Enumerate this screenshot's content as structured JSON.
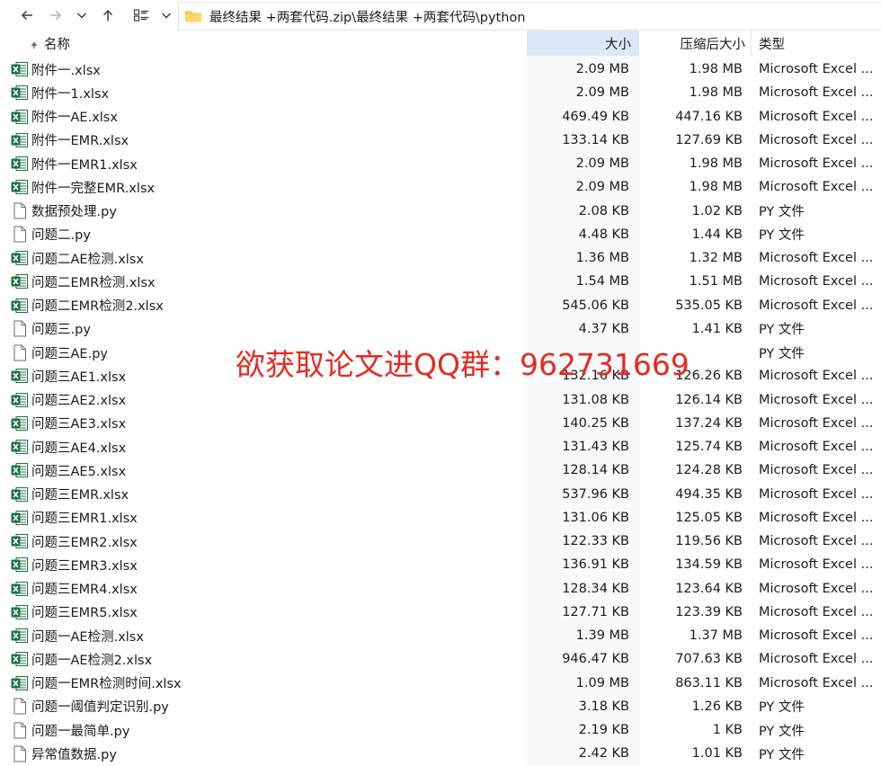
{
  "navigation": {
    "back_icon": "arrow-left-icon",
    "forward_icon": "arrow-right-icon",
    "recent_icon": "chevron-down-icon",
    "up_icon": "arrow-up-icon",
    "view_icon": "view-layout-icon",
    "view_menu_icon": "chevron-down-icon"
  },
  "address_bar": {
    "path": "最终结果 +两套代码.zip\\最终结果 +两套代码\\python"
  },
  "columns": {
    "name": "名称",
    "size": "大小",
    "compressed": "压缩后大小",
    "type": "类型"
  },
  "files": [
    {
      "name": "附件一.xlsx",
      "size": "2.09 MB",
      "compressed": "1.98 MB",
      "type": "Microsoft Excel ...",
      "icon": "excel"
    },
    {
      "name": "附件一1.xlsx",
      "size": "2.09 MB",
      "compressed": "1.98 MB",
      "type": "Microsoft Excel ...",
      "icon": "excel"
    },
    {
      "name": "附件一AE.xlsx",
      "size": "469.49 KB",
      "compressed": "447.16 KB",
      "type": "Microsoft Excel ...",
      "icon": "excel"
    },
    {
      "name": "附件一EMR.xlsx",
      "size": "133.14 KB",
      "compressed": "127.69 KB",
      "type": "Microsoft Excel ...",
      "icon": "excel"
    },
    {
      "name": "附件一EMR1.xlsx",
      "size": "2.09 MB",
      "compressed": "1.98 MB",
      "type": "Microsoft Excel ...",
      "icon": "excel"
    },
    {
      "name": "附件一完整EMR.xlsx",
      "size": "2.09 MB",
      "compressed": "1.98 MB",
      "type": "Microsoft Excel ...",
      "icon": "excel"
    },
    {
      "name": "数据预处理.py",
      "size": "2.08 KB",
      "compressed": "1.02 KB",
      "type": "PY 文件",
      "icon": "file"
    },
    {
      "name": "问题二.py",
      "size": "4.48 KB",
      "compressed": "1.44 KB",
      "type": "PY 文件",
      "icon": "file"
    },
    {
      "name": "问题二AE检测.xlsx",
      "size": "1.36 MB",
      "compressed": "1.32 MB",
      "type": "Microsoft Excel ...",
      "icon": "excel"
    },
    {
      "name": "问题二EMR检测.xlsx",
      "size": "1.54 MB",
      "compressed": "1.51 MB",
      "type": "Microsoft Excel ...",
      "icon": "excel"
    },
    {
      "name": "问题二EMR检测2.xlsx",
      "size": "545.06 KB",
      "compressed": "535.05 KB",
      "type": "Microsoft Excel ...",
      "icon": "excel"
    },
    {
      "name": "问题三.py",
      "size": "4.37 KB",
      "compressed": "1.41 KB",
      "type": "PY 文件",
      "icon": "file"
    },
    {
      "name": "问题三AE.py",
      "size": "",
      "compressed": "",
      "type": "PY 文件",
      "icon": "file"
    },
    {
      "name": "问题三AE1.xlsx",
      "size": "132.16 KB",
      "compressed": "126.26 KB",
      "type": "Microsoft Excel ...",
      "icon": "excel"
    },
    {
      "name": "问题三AE2.xlsx",
      "size": "131.08 KB",
      "compressed": "126.14 KB",
      "type": "Microsoft Excel ...",
      "icon": "excel"
    },
    {
      "name": "问题三AE3.xlsx",
      "size": "140.25 KB",
      "compressed": "137.24 KB",
      "type": "Microsoft Excel ...",
      "icon": "excel"
    },
    {
      "name": "问题三AE4.xlsx",
      "size": "131.43 KB",
      "compressed": "125.74 KB",
      "type": "Microsoft Excel ...",
      "icon": "excel"
    },
    {
      "name": "问题三AE5.xlsx",
      "size": "128.14 KB",
      "compressed": "124.28 KB",
      "type": "Microsoft Excel ...",
      "icon": "excel"
    },
    {
      "name": "问题三EMR.xlsx",
      "size": "537.96 KB",
      "compressed": "494.35 KB",
      "type": "Microsoft Excel ...",
      "icon": "excel"
    },
    {
      "name": "问题三EMR1.xlsx",
      "size": "131.06 KB",
      "compressed": "125.05 KB",
      "type": "Microsoft Excel ...",
      "icon": "excel"
    },
    {
      "name": "问题三EMR2.xlsx",
      "size": "122.33 KB",
      "compressed": "119.56 KB",
      "type": "Microsoft Excel ...",
      "icon": "excel"
    },
    {
      "name": "问题三EMR3.xlsx",
      "size": "136.91 KB",
      "compressed": "134.59 KB",
      "type": "Microsoft Excel ...",
      "icon": "excel"
    },
    {
      "name": "问题三EMR4.xlsx",
      "size": "128.34 KB",
      "compressed": "123.64 KB",
      "type": "Microsoft Excel ...",
      "icon": "excel"
    },
    {
      "name": "问题三EMR5.xlsx",
      "size": "127.71 KB",
      "compressed": "123.39 KB",
      "type": "Microsoft Excel ...",
      "icon": "excel"
    },
    {
      "name": "问题一AE检测.xlsx",
      "size": "1.39 MB",
      "compressed": "1.37 MB",
      "type": "Microsoft Excel ...",
      "icon": "excel"
    },
    {
      "name": "问题一AE检测2.xlsx",
      "size": "946.47 KB",
      "compressed": "707.63 KB",
      "type": "Microsoft Excel ...",
      "icon": "excel"
    },
    {
      "name": "问题一EMR检测时间.xlsx",
      "size": "1.09 MB",
      "compressed": "863.11 KB",
      "type": "Microsoft Excel ...",
      "icon": "excel"
    },
    {
      "name": "问题一阈值判定识别.py",
      "size": "3.18 KB",
      "compressed": "1.26 KB",
      "type": "PY 文件",
      "icon": "file"
    },
    {
      "name": "问题一最简单.py",
      "size": "2.19 KB",
      "compressed": "1 KB",
      "type": "PY 文件",
      "icon": "file"
    },
    {
      "name": "异常值数据.py",
      "size": "2.42 KB",
      "compressed": "1.01 KB",
      "type": "PY 文件",
      "icon": "file"
    }
  ],
  "watermark": "欲获取论文进QQ群：962731669",
  "colors": {
    "selected_column": "#dbe8f7",
    "watermark": "#e52a21",
    "excel_green": "#1d7044",
    "folder_yellow": "#f5c342"
  }
}
